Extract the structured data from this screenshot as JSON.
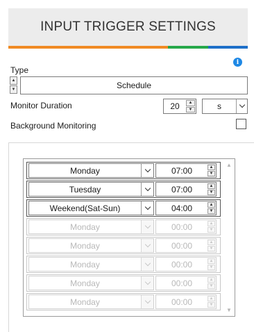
{
  "header": {
    "title": "INPUT TRIGGER SETTINGS"
  },
  "colors": {
    "bar": [
      "#f08a24",
      "#f08a24",
      "#f08a24",
      "#f08a24",
      "#27a84a",
      "#1e6fc8"
    ]
  },
  "type": {
    "label": "Type",
    "value": "Schedule"
  },
  "monitor_duration": {
    "label": "Monitor Duration",
    "value": "20",
    "unit": "s"
  },
  "background_monitoring": {
    "label": "Background Monitoring",
    "checked": false
  },
  "schedule": {
    "rows": [
      {
        "day": "Monday",
        "time": "07:00",
        "enabled": true
      },
      {
        "day": "Tuesday",
        "time": "07:00",
        "enabled": true
      },
      {
        "day": "Weekend(Sat-Sun)",
        "time": "04:00",
        "enabled": true
      },
      {
        "day": "Monday",
        "time": "00:00",
        "enabled": false
      },
      {
        "day": "Monday",
        "time": "00:00",
        "enabled": false
      },
      {
        "day": "Monday",
        "time": "00:00",
        "enabled": false
      },
      {
        "day": "Monday",
        "time": "00:00",
        "enabled": false
      },
      {
        "day": "Monday",
        "time": "00:00",
        "enabled": false
      }
    ]
  }
}
